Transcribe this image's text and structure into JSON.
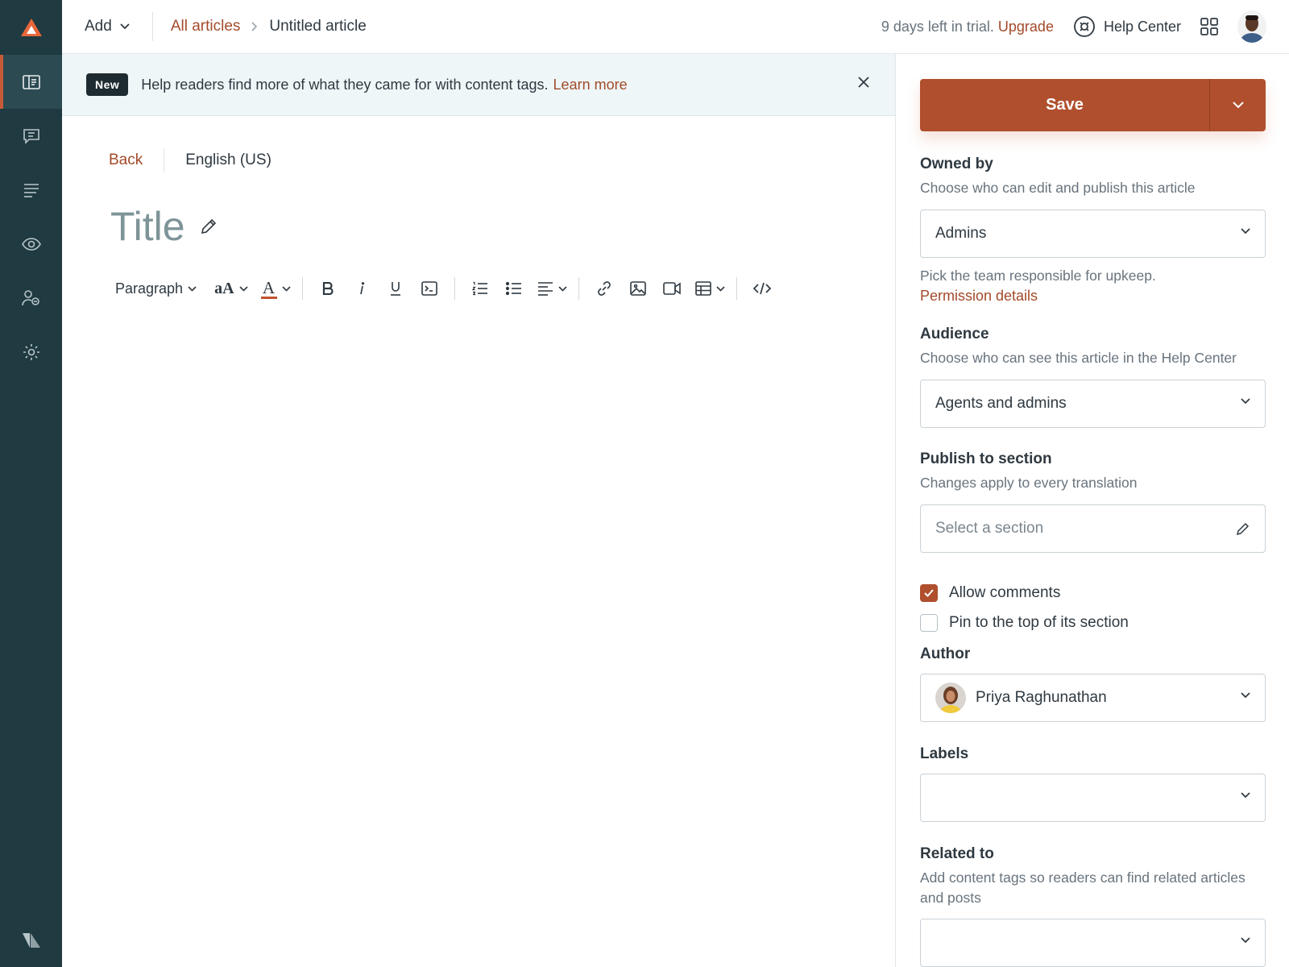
{
  "topbar": {
    "add_label": "Add",
    "breadcrumb_link": "All articles",
    "breadcrumb_current": "Untitled article",
    "trial_text": "9 days left in trial.",
    "upgrade_label": "Upgrade",
    "help_center_label": "Help Center"
  },
  "leftnav": {
    "items": [
      {
        "icon": "articles-icon",
        "active": true
      },
      {
        "icon": "community-icon",
        "active": false
      },
      {
        "icon": "list-icon",
        "active": false
      },
      {
        "icon": "eye-icon",
        "active": false
      },
      {
        "icon": "user-management-icon",
        "active": false
      },
      {
        "icon": "settings-icon",
        "active": false
      }
    ]
  },
  "banner": {
    "badge": "New",
    "text": "Help readers find more of what they came for with content tags.",
    "learn_more": "Learn more"
  },
  "editor": {
    "back_label": "Back",
    "language": "English (US)",
    "title_placeholder": "Title",
    "toolbar": {
      "paragraph_label": "Paragraph",
      "font_size_label": "aA",
      "text_color_label": "A"
    }
  },
  "sidebar": {
    "save_label": "Save",
    "owned_by": {
      "label": "Owned by",
      "help": "Choose who can edit and publish this article",
      "value": "Admins",
      "help2": "Pick the team responsible for upkeep.",
      "link": "Permission details"
    },
    "audience": {
      "label": "Audience",
      "help": "Choose who can see this article in the Help Center",
      "value": "Agents and admins"
    },
    "publish": {
      "label": "Publish to section",
      "help": "Changes apply to every translation",
      "placeholder": "Select a section"
    },
    "allow_comments": {
      "label": "Allow comments",
      "checked": true
    },
    "pin_top": {
      "label": "Pin to the top of its section",
      "checked": false
    },
    "author": {
      "label": "Author",
      "value": "Priya Raghunathan"
    },
    "labels": {
      "label": "Labels",
      "value": ""
    },
    "related": {
      "label": "Related to",
      "help": "Add content tags so readers can find related articles and posts",
      "value": ""
    }
  },
  "colors": {
    "accent": "#b04f2d",
    "nav_bg": "#1f3a40",
    "banner_bg": "#eef6f8"
  }
}
